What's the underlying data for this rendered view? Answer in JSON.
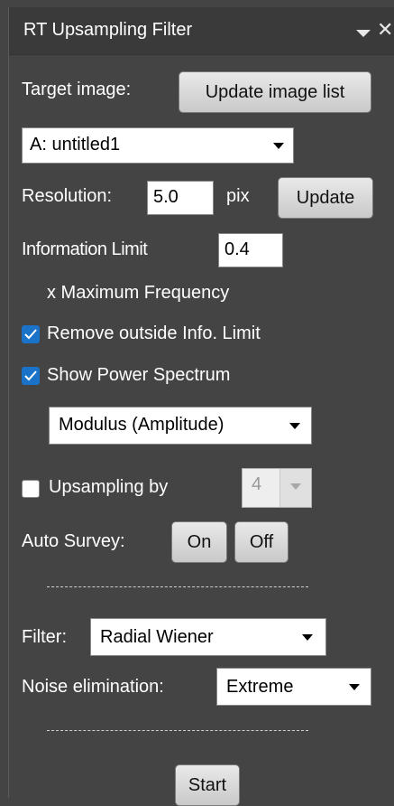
{
  "title": "RT Upsampling Filter",
  "target_image": {
    "label": "Target image:",
    "update_button": "Update image list",
    "selected": "A: untitled1"
  },
  "resolution": {
    "label": "Resolution:",
    "value": "5.0",
    "unit": "pix",
    "update_button": "Update"
  },
  "information_limit": {
    "label": "Information Limit",
    "value": "0.4",
    "suffix": "x Maximum Frequency"
  },
  "remove_outside": {
    "label": "Remove outside Info. Limit",
    "checked": true
  },
  "show_power_spectrum": {
    "label": "Show Power Spectrum",
    "checked": true
  },
  "spectrum_mode": {
    "selected": "Modulus (Amplitude)"
  },
  "upsampling": {
    "label": "Upsampling by",
    "checked": false,
    "value": "4"
  },
  "auto_survey": {
    "label": "Auto Survey:",
    "on_button": "On",
    "off_button": "Off"
  },
  "filter": {
    "label": "Filter:",
    "selected": "Radial Wiener"
  },
  "noise_elimination": {
    "label": "Noise elimination:",
    "selected": "Extreme"
  },
  "start_button": "Start",
  "colors": {
    "panel_bg": "#444444",
    "title_bg": "#3a3a3a",
    "check_accent": "#1a73c9"
  },
  "icons": {
    "collapse": "chevron-down-icon",
    "close": "close-icon",
    "check": "check-icon"
  }
}
